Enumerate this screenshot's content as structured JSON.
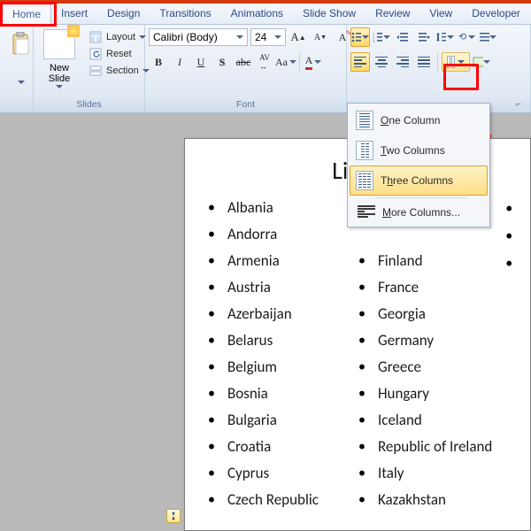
{
  "tabs": [
    "Home",
    "Insert",
    "Design",
    "Transitions",
    "Animations",
    "Slide Show",
    "Review",
    "View",
    "Developer"
  ],
  "active_tab": 0,
  "ribbon": {
    "slides": {
      "new_slide": "New\nSlide",
      "layout": "Layout",
      "reset": "Reset",
      "section": "Section",
      "label": "Slides"
    },
    "font": {
      "name": "Calibri (Body)",
      "size": "24",
      "label": "Font"
    }
  },
  "columns_menu": {
    "one": "One Column",
    "two": "Two Columns",
    "three": "Three Columns",
    "more": "More Columns..."
  },
  "slide": {
    "title": "List of",
    "col1": [
      "Albania",
      "Andorra",
      "Armenia",
      "Austria",
      "Azerbaijan",
      "Belarus",
      "Belgium",
      "Bosnia",
      "Bulgaria",
      "Croatia",
      "Cyprus",
      "Czech Republic"
    ],
    "col2_partial_first": "Finland",
    "col2": [
      "France",
      "Georgia",
      "Germany",
      "Greece",
      "Hungary",
      "Iceland",
      "Republic of Ireland",
      "Italy",
      "Kazakhstan"
    ]
  }
}
